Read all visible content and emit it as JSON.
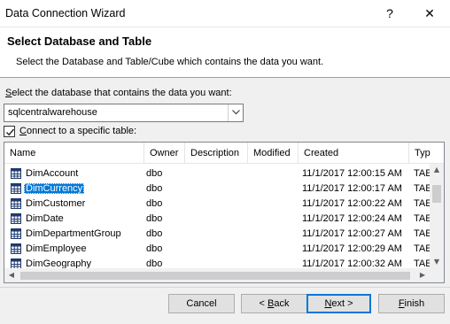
{
  "window": {
    "title": "Data Connection Wizard",
    "help_glyph": "?",
    "close_glyph": "✕"
  },
  "header": {
    "title": "Select Database and Table",
    "subtitle": "Select the Database and Table/Cube which contains the data you want."
  },
  "database": {
    "label": "Select the database that contains the data you want:",
    "label_mnemonic": "S",
    "label_rest": "elect the database that contains the data you want:",
    "value": "sqlcentralwarehouse"
  },
  "connect_checkbox": {
    "checked": true,
    "label_mnemonic": "C",
    "label_rest": "onnect to a specific table:"
  },
  "table": {
    "columns": [
      "Name",
      "Owner",
      "Description",
      "Modified",
      "Created",
      "Typ"
    ],
    "rows": [
      {
        "name": "DimAccount",
        "owner": "dbo",
        "description": "",
        "modified": "",
        "created": "11/1/2017 12:00:15 AM",
        "type": "TAE"
      },
      {
        "name": "DimCurrency",
        "owner": "dbo",
        "description": "",
        "modified": "",
        "created": "11/1/2017 12:00:17 AM",
        "type": "TAE",
        "selected": true
      },
      {
        "name": "DimCustomer",
        "owner": "dbo",
        "description": "",
        "modified": "",
        "created": "11/1/2017 12:00:22 AM",
        "type": "TAE"
      },
      {
        "name": "DimDate",
        "owner": "dbo",
        "description": "",
        "modified": "",
        "created": "11/1/2017 12:00:24 AM",
        "type": "TAE"
      },
      {
        "name": "DimDepartmentGroup",
        "owner": "dbo",
        "description": "",
        "modified": "",
        "created": "11/1/2017 12:00:27 AM",
        "type": "TAE"
      },
      {
        "name": "DimEmployee",
        "owner": "dbo",
        "description": "",
        "modified": "",
        "created": "11/1/2017 12:00:29 AM",
        "type": "TAE"
      },
      {
        "name": "DimGeography",
        "owner": "dbo",
        "description": "",
        "modified": "",
        "created": "11/1/2017 12:00:32 AM",
        "type": "TAE"
      }
    ]
  },
  "buttons": {
    "cancel": "Cancel",
    "back_prefix": "< ",
    "back_mnemonic": "B",
    "back_rest": "ack",
    "next_mnemonic": "N",
    "next_rest": "ext >",
    "finish_mnemonic": "F",
    "finish_rest": "inish"
  },
  "colors": {
    "selection": "#0078d7",
    "default_button_border": "#0078d7"
  },
  "icons": {
    "table_row": "table-icon",
    "dropdown": "chevron-down-icon",
    "checkbox": "checkmark-icon"
  }
}
